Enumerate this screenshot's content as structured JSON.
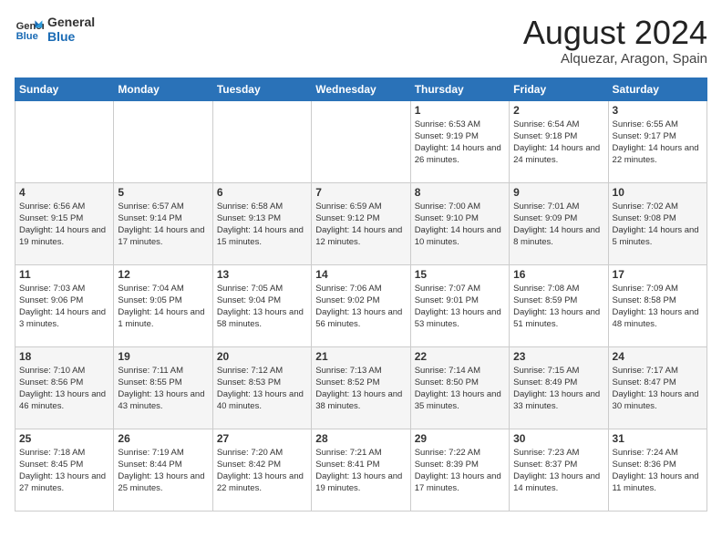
{
  "header": {
    "logo_general": "General",
    "logo_blue": "Blue",
    "month_year": "August 2024",
    "location": "Alquezar, Aragon, Spain"
  },
  "days_of_week": [
    "Sunday",
    "Monday",
    "Tuesday",
    "Wednesday",
    "Thursday",
    "Friday",
    "Saturday"
  ],
  "weeks": [
    [
      {
        "day": "",
        "info": ""
      },
      {
        "day": "",
        "info": ""
      },
      {
        "day": "",
        "info": ""
      },
      {
        "day": "",
        "info": ""
      },
      {
        "day": "1",
        "info": "Sunrise: 6:53 AM\nSunset: 9:19 PM\nDaylight: 14 hours\nand 26 minutes."
      },
      {
        "day": "2",
        "info": "Sunrise: 6:54 AM\nSunset: 9:18 PM\nDaylight: 14 hours\nand 24 minutes."
      },
      {
        "day": "3",
        "info": "Sunrise: 6:55 AM\nSunset: 9:17 PM\nDaylight: 14 hours\nand 22 minutes."
      }
    ],
    [
      {
        "day": "4",
        "info": "Sunrise: 6:56 AM\nSunset: 9:15 PM\nDaylight: 14 hours\nand 19 minutes."
      },
      {
        "day": "5",
        "info": "Sunrise: 6:57 AM\nSunset: 9:14 PM\nDaylight: 14 hours\nand 17 minutes."
      },
      {
        "day": "6",
        "info": "Sunrise: 6:58 AM\nSunset: 9:13 PM\nDaylight: 14 hours\nand 15 minutes."
      },
      {
        "day": "7",
        "info": "Sunrise: 6:59 AM\nSunset: 9:12 PM\nDaylight: 14 hours\nand 12 minutes."
      },
      {
        "day": "8",
        "info": "Sunrise: 7:00 AM\nSunset: 9:10 PM\nDaylight: 14 hours\nand 10 minutes."
      },
      {
        "day": "9",
        "info": "Sunrise: 7:01 AM\nSunset: 9:09 PM\nDaylight: 14 hours\nand 8 minutes."
      },
      {
        "day": "10",
        "info": "Sunrise: 7:02 AM\nSunset: 9:08 PM\nDaylight: 14 hours\nand 5 minutes."
      }
    ],
    [
      {
        "day": "11",
        "info": "Sunrise: 7:03 AM\nSunset: 9:06 PM\nDaylight: 14 hours\nand 3 minutes."
      },
      {
        "day": "12",
        "info": "Sunrise: 7:04 AM\nSunset: 9:05 PM\nDaylight: 14 hours\nand 1 minute."
      },
      {
        "day": "13",
        "info": "Sunrise: 7:05 AM\nSunset: 9:04 PM\nDaylight: 13 hours\nand 58 minutes."
      },
      {
        "day": "14",
        "info": "Sunrise: 7:06 AM\nSunset: 9:02 PM\nDaylight: 13 hours\nand 56 minutes."
      },
      {
        "day": "15",
        "info": "Sunrise: 7:07 AM\nSunset: 9:01 PM\nDaylight: 13 hours\nand 53 minutes."
      },
      {
        "day": "16",
        "info": "Sunrise: 7:08 AM\nSunset: 8:59 PM\nDaylight: 13 hours\nand 51 minutes."
      },
      {
        "day": "17",
        "info": "Sunrise: 7:09 AM\nSunset: 8:58 PM\nDaylight: 13 hours\nand 48 minutes."
      }
    ],
    [
      {
        "day": "18",
        "info": "Sunrise: 7:10 AM\nSunset: 8:56 PM\nDaylight: 13 hours\nand 46 minutes."
      },
      {
        "day": "19",
        "info": "Sunrise: 7:11 AM\nSunset: 8:55 PM\nDaylight: 13 hours\nand 43 minutes."
      },
      {
        "day": "20",
        "info": "Sunrise: 7:12 AM\nSunset: 8:53 PM\nDaylight: 13 hours\nand 40 minutes."
      },
      {
        "day": "21",
        "info": "Sunrise: 7:13 AM\nSunset: 8:52 PM\nDaylight: 13 hours\nand 38 minutes."
      },
      {
        "day": "22",
        "info": "Sunrise: 7:14 AM\nSunset: 8:50 PM\nDaylight: 13 hours\nand 35 minutes."
      },
      {
        "day": "23",
        "info": "Sunrise: 7:15 AM\nSunset: 8:49 PM\nDaylight: 13 hours\nand 33 minutes."
      },
      {
        "day": "24",
        "info": "Sunrise: 7:17 AM\nSunset: 8:47 PM\nDaylight: 13 hours\nand 30 minutes."
      }
    ],
    [
      {
        "day": "25",
        "info": "Sunrise: 7:18 AM\nSunset: 8:45 PM\nDaylight: 13 hours\nand 27 minutes."
      },
      {
        "day": "26",
        "info": "Sunrise: 7:19 AM\nSunset: 8:44 PM\nDaylight: 13 hours\nand 25 minutes."
      },
      {
        "day": "27",
        "info": "Sunrise: 7:20 AM\nSunset: 8:42 PM\nDaylight: 13 hours\nand 22 minutes."
      },
      {
        "day": "28",
        "info": "Sunrise: 7:21 AM\nSunset: 8:41 PM\nDaylight: 13 hours\nand 19 minutes."
      },
      {
        "day": "29",
        "info": "Sunrise: 7:22 AM\nSunset: 8:39 PM\nDaylight: 13 hours\nand 17 minutes."
      },
      {
        "day": "30",
        "info": "Sunrise: 7:23 AM\nSunset: 8:37 PM\nDaylight: 13 hours\nand 14 minutes."
      },
      {
        "day": "31",
        "info": "Sunrise: 7:24 AM\nSunset: 8:36 PM\nDaylight: 13 hours\nand 11 minutes."
      }
    ]
  ]
}
